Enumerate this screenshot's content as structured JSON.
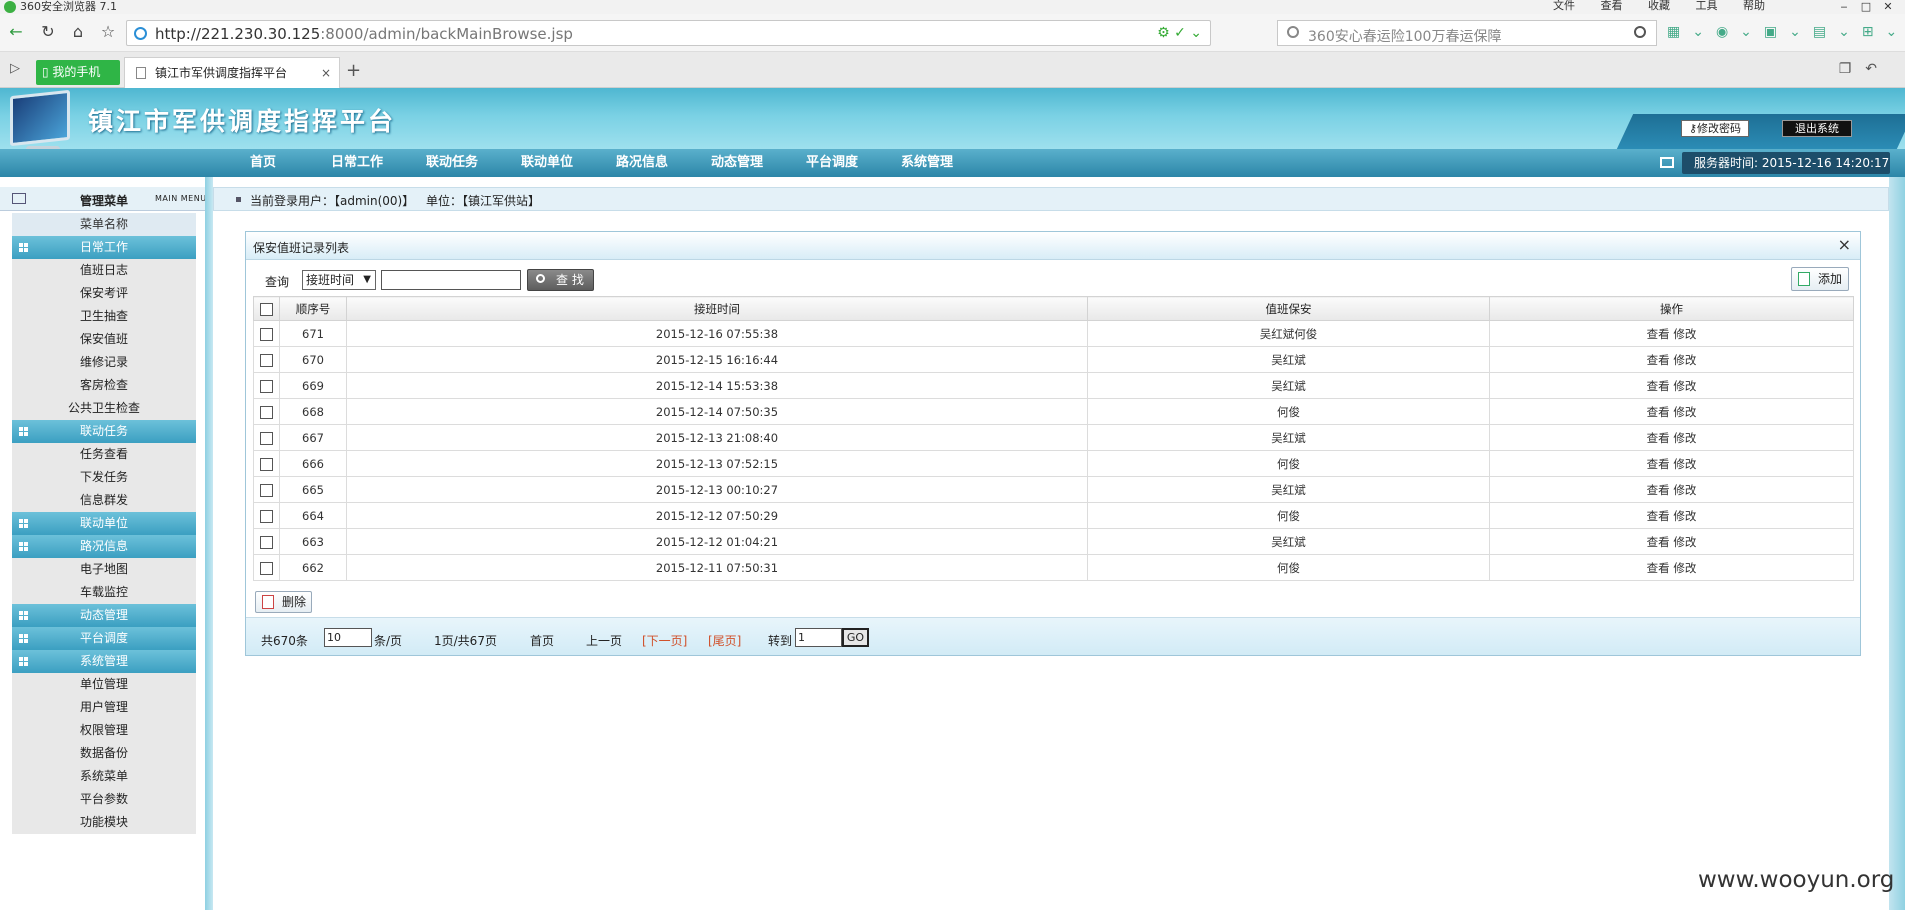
{
  "browser": {
    "window_title": "360安全浏览器 7.1",
    "menus": [
      "文件",
      "查看",
      "收藏",
      "工具",
      "帮助"
    ],
    "url_host": "http://221.230.30.125",
    "url_rest": ":8000/admin/backMainBrowse.jsp",
    "search_placeholder": "360安心春运险100万春运保障",
    "mobile_tab": "我的手机",
    "active_tab": "镇江市军供调度指挥平台",
    "close_tab": "×",
    "new_tab": "+"
  },
  "header": {
    "app_title": "镇江市军供调度指挥平台",
    "change_password": "修改密码",
    "exit_system": "退出系统",
    "nav": [
      "首页",
      "日常工作",
      "联动任务",
      "联动单位",
      "路况信息",
      "动态管理",
      "平台调度",
      "系统管理"
    ],
    "server_time": "服务器时间: 2015-12-16 14:20:17"
  },
  "sidebar": {
    "title": "管理菜单",
    "subtitle": "MAIN MENU",
    "column_header": "菜单名称",
    "rows": [
      {
        "label": "日常工作",
        "type": "cat"
      },
      {
        "label": "值班日志",
        "type": "item"
      },
      {
        "label": "保安考评",
        "type": "item"
      },
      {
        "label": "卫生抽查",
        "type": "item"
      },
      {
        "label": "保安值班",
        "type": "item"
      },
      {
        "label": "维修记录",
        "type": "item"
      },
      {
        "label": "客房检查",
        "type": "item"
      },
      {
        "label": "公共卫生检查",
        "type": "item"
      },
      {
        "label": "联动任务",
        "type": "cat"
      },
      {
        "label": "任务查看",
        "type": "item"
      },
      {
        "label": "下发任务",
        "type": "item"
      },
      {
        "label": "信息群发",
        "type": "item"
      },
      {
        "label": "联动单位",
        "type": "cat"
      },
      {
        "label": "路况信息",
        "type": "cat"
      },
      {
        "label": "电子地图",
        "type": "item"
      },
      {
        "label": "车载监控",
        "type": "item"
      },
      {
        "label": "动态管理",
        "type": "cat"
      },
      {
        "label": "平台调度",
        "type": "cat"
      },
      {
        "label": "系统管理",
        "type": "cat"
      },
      {
        "label": "单位管理",
        "type": "item"
      },
      {
        "label": "用户管理",
        "type": "item"
      },
      {
        "label": "权限管理",
        "type": "item"
      },
      {
        "label": "数据备份",
        "type": "item"
      },
      {
        "label": "系统菜单",
        "type": "item"
      },
      {
        "label": "平台参数",
        "type": "item"
      },
      {
        "label": "功能模块",
        "type": "item"
      }
    ]
  },
  "login": {
    "user": "当前登录用户：【admin(00)】",
    "unit": "单位：【镇江军供站】"
  },
  "panel": {
    "title": "保安值班记录列表",
    "close": "×",
    "query_label": "查询",
    "query_field": "接班时间",
    "search_button": "查 找",
    "add_button": "添加",
    "delete_button": "删除",
    "columns": [
      "顺序号",
      "接班时间",
      "值班保安",
      "操作"
    ],
    "rows": [
      {
        "id": "671",
        "time": "2015-12-16 07:55:38",
        "guard": "吴红斌何俊"
      },
      {
        "id": "670",
        "time": "2015-12-15 16:16:44",
        "guard": "吴红斌"
      },
      {
        "id": "669",
        "time": "2015-12-14 15:53:38",
        "guard": "吴红斌"
      },
      {
        "id": "668",
        "time": "2015-12-14 07:50:35",
        "guard": "何俊"
      },
      {
        "id": "667",
        "time": "2015-12-13 21:08:40",
        "guard": "吴红斌"
      },
      {
        "id": "666",
        "time": "2015-12-13 07:52:15",
        "guard": "何俊"
      },
      {
        "id": "665",
        "time": "2015-12-13 00:10:27",
        "guard": "吴红斌"
      },
      {
        "id": "664",
        "time": "2015-12-12 07:50:29",
        "guard": "何俊"
      },
      {
        "id": "663",
        "time": "2015-12-12 01:04:21",
        "guard": "吴红斌"
      },
      {
        "id": "662",
        "time": "2015-12-11 07:50:31",
        "guard": "何俊"
      }
    ],
    "view_label": "查看",
    "edit_label": "修改",
    "pager": {
      "total": "共670条",
      "page_size": "10",
      "per_page": "条/页",
      "page_info": "1页/共67页",
      "first": "首页",
      "prev": "上一页",
      "next": "[下一页]",
      "last": "[尾页]",
      "goto": "转到",
      "goto_value": "1",
      "go": "GO"
    }
  },
  "watermark": "www.wooyun.org"
}
